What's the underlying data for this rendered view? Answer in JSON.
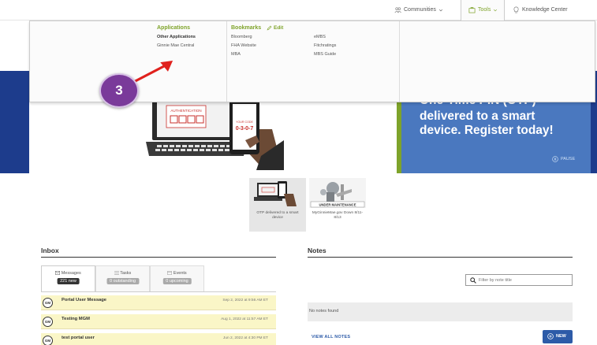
{
  "topbar": {
    "communities": "Communities",
    "tools": "Tools",
    "knowledge_center": "Knowledge Center"
  },
  "mega_menu": {
    "applications": {
      "heading": "Applications",
      "items": [
        "Other Applications",
        "Ginnie Mae Central"
      ]
    },
    "bookmarks": {
      "heading": "Bookmarks",
      "edit_label": "Edit",
      "col1": [
        "Bloomberg",
        "FHA Website",
        "MBA"
      ],
      "col2": [
        "eMBS",
        "Fitchratings",
        "MBS Guide"
      ]
    }
  },
  "hero": {
    "headline_lines": [
      "One-Time PIN (OTP)",
      "delivered to a smart",
      "device. Register today!"
    ],
    "pause_label": "PAUSE",
    "device_text": {
      "authentication": "AUTHENTICATION",
      "your_code": "YOUR CODE",
      "code": "0-3-0-7"
    }
  },
  "thumbnails": [
    {
      "caption": "OTP delivered to a smart device"
    },
    {
      "caption": "MyGinnieMae.gov Down 8/11-8/13",
      "sign": "UNDER MAINTENANCE"
    }
  ],
  "inbox": {
    "title": "Inbox",
    "tabs": [
      {
        "label": "Messages",
        "badge": "221 new"
      },
      {
        "label": "Tasks",
        "badge": "0 outstanding"
      },
      {
        "label": "Events",
        "badge": "0 upcoming"
      }
    ],
    "messages": [
      {
        "avatar": "GM",
        "title": "Portal User Message",
        "date": "Sep 2, 2022 at 9:56 AM ET"
      },
      {
        "avatar": "GM",
        "title": "Testing MGM",
        "date": "Aug 1, 2022 at 11:57 AM ET"
      },
      {
        "avatar": "GM",
        "title": "test portal user",
        "date": "Jun 2, 2022 at 4:30 PM ET"
      }
    ]
  },
  "notes": {
    "title": "Notes",
    "filter_placeholder": "Filter by note title",
    "empty_text": "No notes found",
    "view_all": "VIEW ALL NOTES",
    "new_label": "NEW"
  },
  "annotation": {
    "step_number": "3"
  },
  "colors": {
    "accent_green": "#7ea32a",
    "hero_blue": "#4a78bf",
    "navy": "#1d3c8c",
    "link_blue": "#2d5ba8",
    "step_purple": "#7a3a9a",
    "arrow_red": "#e0211d",
    "inbox_row": "#faf6c7"
  }
}
